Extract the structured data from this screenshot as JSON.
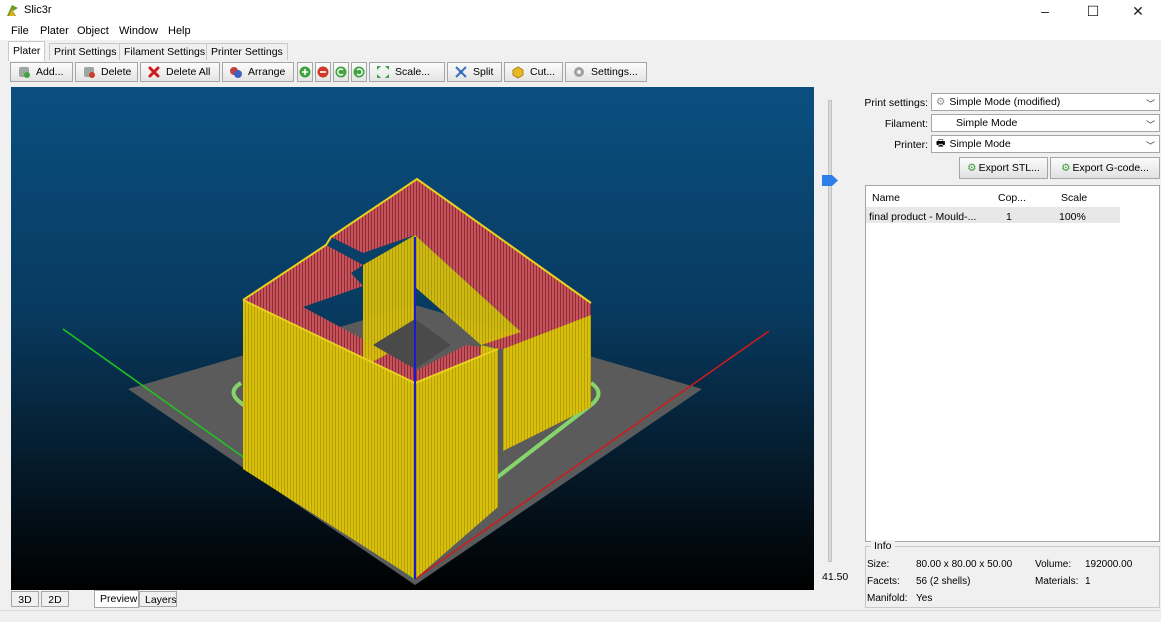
{
  "window": {
    "title": "Slic3r",
    "minimize": "–",
    "maximize": "☐",
    "close": "✕"
  },
  "menu": [
    "File",
    "Plater",
    "Object",
    "Window",
    "Help"
  ],
  "tabs": [
    "Plater",
    "Print Settings",
    "Filament Settings",
    "Printer Settings"
  ],
  "toolbar": {
    "add": "Add...",
    "delete": "Delete",
    "delete_all": "Delete All",
    "arrange": "Arrange",
    "scale": "Scale...",
    "split": "Split",
    "cut": "Cut...",
    "settings": "Settings..."
  },
  "icons": {
    "add": "add-icon",
    "delete": "delete-icon",
    "delete_all": "delete-all-icon",
    "arrange": "arrange-icon",
    "increase": "increase-copies-icon",
    "decrease": "decrease-copies-icon",
    "rotate_left": "rotate-left-icon",
    "rotate_right": "rotate-right-icon",
    "scale": "scale-icon",
    "split": "split-icon",
    "cut": "cut-icon",
    "settings": "gear-icon"
  },
  "viewport": {
    "layer_height": "41.50"
  },
  "view_tabs": [
    "3D",
    "2D",
    "Preview",
    "Layers"
  ],
  "right_panel": {
    "print_settings_label": "Print settings:",
    "print_settings_value": "Simple Mode (modified)",
    "filament_label": "Filament:",
    "filament_value": "Simple Mode",
    "printer_label": "Printer:",
    "printer_value": "Simple Mode",
    "export_stl": "Export STL...",
    "export_gcode": "Export G-code..."
  },
  "object_list": {
    "columns": [
      "Name",
      "Cop...",
      "Scale"
    ],
    "rows": [
      {
        "name": "final product - Mould-...",
        "copies": "1",
        "scale": "100%"
      }
    ]
  },
  "info": {
    "title": "Info",
    "size_label": "Size:",
    "size_value": "80.00 x 80.00 x 50.00",
    "volume_label": "Volume:",
    "volume_value": "192000.00",
    "facets_label": "Facets:",
    "facets_value": "56 (2 shells)",
    "materials_label": "Materials:",
    "materials_value": "1",
    "manifold_label": "Manifold:",
    "manifold_value": "Yes"
  },
  "colors": {
    "object_yellow": "#d9c20a",
    "infill_red": "#c8525b",
    "bed": "#5b5b5b",
    "skirt": "#86d46a",
    "axis_x": "#d11a1a",
    "axis_y": "#1ec81e",
    "axis_z": "#1a1ad6"
  }
}
